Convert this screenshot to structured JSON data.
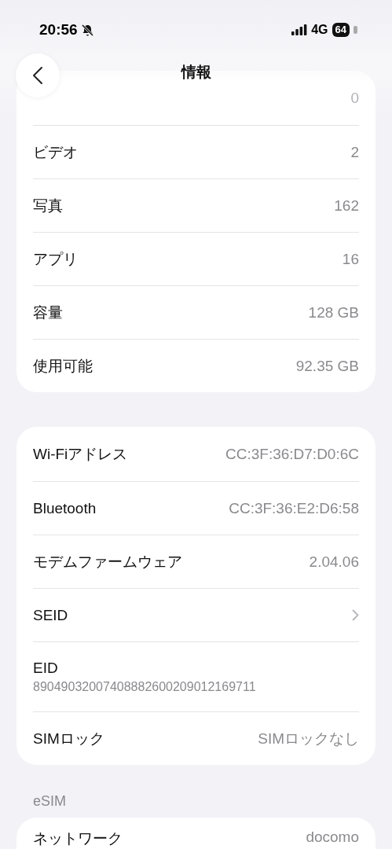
{
  "status_bar": {
    "time": "20:56",
    "network": "4G",
    "battery": "64"
  },
  "nav": {
    "title": "情報"
  },
  "sections": [
    {
      "rows": [
        {
          "kind": "partial",
          "value": "0"
        },
        {
          "kind": "value",
          "label": "ビデオ",
          "value": "2"
        },
        {
          "kind": "value",
          "label": "写真",
          "value": "162"
        },
        {
          "kind": "value",
          "label": "アプリ",
          "value": "16"
        },
        {
          "kind": "value",
          "label": "容量",
          "value": "128 GB"
        },
        {
          "kind": "value",
          "label": "使用可能",
          "value": "92.35 GB"
        }
      ]
    },
    {
      "rows": [
        {
          "kind": "value",
          "label": "Wi-Fiアドレス",
          "value": "CC:3F:36:D7:D0:6C"
        },
        {
          "kind": "value",
          "label": "Bluetooth",
          "value": "CC:3F:36:E2:D6:58"
        },
        {
          "kind": "value",
          "label": "モデムファームウェア",
          "value": "2.04.06"
        },
        {
          "kind": "link",
          "label": "SEID"
        },
        {
          "kind": "stacked",
          "label": "EID",
          "value": "89049032007408882600209012169711"
        },
        {
          "kind": "value",
          "label": "SIMロック",
          "value": "SIMロックなし"
        }
      ]
    },
    {
      "header": "eSIM",
      "rows": [
        {
          "kind": "value",
          "label": "ネットワーク",
          "value": "docomo"
        }
      ]
    }
  ]
}
